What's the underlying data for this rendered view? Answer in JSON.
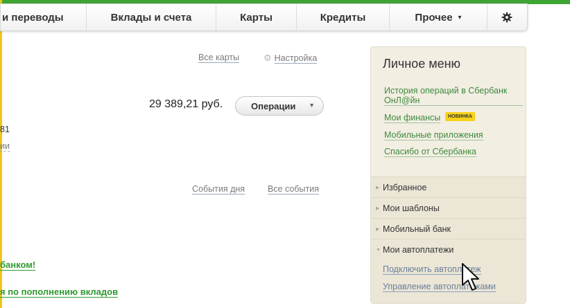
{
  "nav": {
    "tabs": [
      {
        "label": "и переводы"
      },
      {
        "label": "Вклады и счета"
      },
      {
        "label": "Карты"
      },
      {
        "label": "Кредиты"
      },
      {
        "label": "Прочее"
      }
    ],
    "caret": "▾",
    "settings_icon": "gear-icon"
  },
  "cards": {
    "all_cards_link": "Все карты",
    "settings_link": "Настройка",
    "amount": "29 389,21 руб.",
    "operations_button": "Операции",
    "cut_number": "81",
    "cut_link": "ии"
  },
  "events": {
    "day_events_link": "События дня",
    "all_events_link": "Все события"
  },
  "promo": {
    "link1": "банком!",
    "link2": "я по пополнению вкладов"
  },
  "personal_menu": {
    "title": "Личное меню",
    "links": [
      "История операций в Сбербанк ОнЛ@йн",
      "Мои финансы",
      "Мобильные приложения",
      "Спасибо от Сбербанка"
    ],
    "badge_new": "НОВИНКА",
    "sections": [
      "Избранное",
      "Мои шаблоны",
      "Мобильный банк",
      "Мои автоплатежи"
    ],
    "autopay_links": [
      "Подключить автоплатеж",
      "Управление автоплатежами"
    ]
  },
  "colors": {
    "brand_green": "#3ea535",
    "link_green": "#3e8a3e",
    "badge_yellow": "#f7d11b"
  }
}
